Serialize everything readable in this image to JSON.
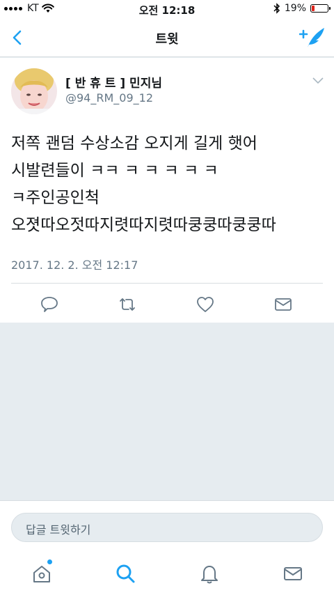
{
  "status_bar": {
    "carrier": "KT",
    "time": "오전 12:18",
    "battery_percent": "19%",
    "battery_level": 0.19,
    "icons": [
      "signal-dots-icon",
      "wifi-icon",
      "bluetooth-icon",
      "battery-icon"
    ]
  },
  "nav": {
    "title": "트윗",
    "icons": [
      "back-chevron-icon",
      "compose-feather-icon"
    ]
  },
  "tweet": {
    "display_name": "[ 반 휴 트 ] 민지님",
    "handle": "@94_RM_09_12",
    "text_lines": [
      "저쪽 괜덤 수상소감 오지게 길게 햇어",
      "시발련들이 ㅋㅋ ㅋ ㅋ ㅋ ㅋ ㅋ",
      "ㅋ주인공인척",
      "오졋따오젓따지렷따지렷따쿵쿵따쿵쿵따"
    ],
    "timestamp": "2017. 12. 2. 오전 12:17",
    "action_icons": [
      "reply-icon",
      "retweet-icon",
      "like-heart-icon",
      "direct-message-icon"
    ]
  },
  "reply": {
    "placeholder": "답글 트윗하기"
  },
  "tab_bar": {
    "icons": [
      "home-icon",
      "search-icon",
      "notifications-bell-icon",
      "messages-icon"
    ],
    "accent_color": "#1da1f2"
  },
  "colors": {
    "brand_blue": "#1da1f2",
    "secondary_text": "#657786",
    "background": "#e6ecf0"
  }
}
